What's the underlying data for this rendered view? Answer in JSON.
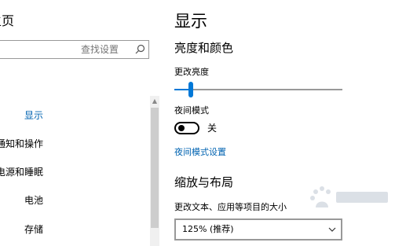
{
  "nav": {
    "heading": "设置主页",
    "search_placeholder": "查找设置",
    "items": [
      {
        "label": "显示",
        "active": true
      },
      {
        "label": "通知和操作",
        "active": false
      },
      {
        "label": "电源和睡眠",
        "active": false
      },
      {
        "label": "电池",
        "active": false
      },
      {
        "label": "存储",
        "active": false
      }
    ]
  },
  "content": {
    "title": "显示",
    "brightness_section": "亮度和颜色",
    "brightness_label": "更改亮度",
    "brightness_value_percent": 10,
    "night_mode_label": "夜间模式",
    "night_mode_state": "关",
    "night_mode_settings_link": "夜间模式设置",
    "scale_section": "缩放与布局",
    "scale_label": "更改文本、应用等项目的大小",
    "scale_value": "125% (推荐)"
  },
  "icons": {
    "search": "search-icon",
    "scroll_up": "chevron-up-icon",
    "dropdown": "chevron-down-icon"
  },
  "colors": {
    "accent": "#0078d7",
    "link": "#0063b1"
  }
}
